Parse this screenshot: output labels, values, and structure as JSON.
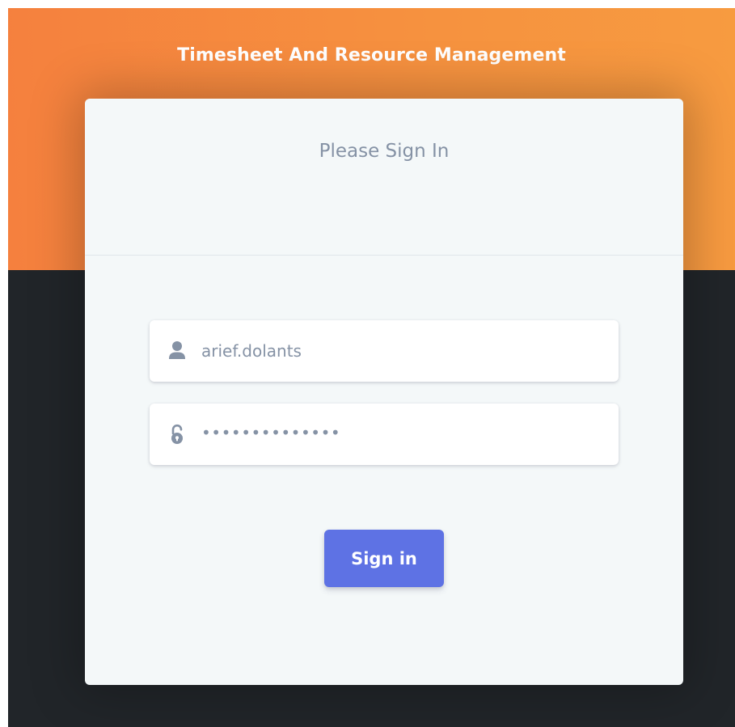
{
  "header": {
    "title": "Timesheet And Resource Management"
  },
  "card": {
    "heading": "Please Sign In"
  },
  "form": {
    "username": {
      "value": "arief.dolants",
      "icon": "user-icon"
    },
    "password": {
      "masked_value": "••••••••••••••",
      "icon": "unlock-icon"
    },
    "submit_label": "Sign in"
  },
  "colors": {
    "hero_start": "#f5803e",
    "hero_end": "#f79b40",
    "page_background": "#212529",
    "card_background": "#f4f8f9",
    "primary_button": "#5e72e4",
    "muted_text": "#8592a5"
  }
}
